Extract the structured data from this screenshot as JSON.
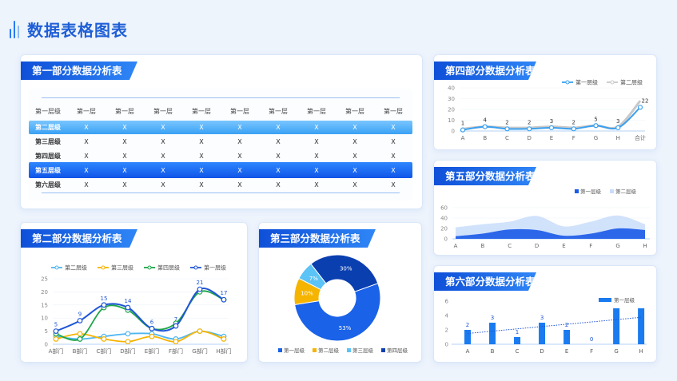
{
  "page_title": "数据表格图表",
  "colors": {
    "accent": "#1f5fd6",
    "banner": "#1a63e6"
  },
  "sections": {
    "s1": {
      "title": "第一部分数据分析表"
    },
    "s2": {
      "title": "第二部分数据分析表"
    },
    "s3": {
      "title": "第三部分数据分析表"
    },
    "s4": {
      "title": "第四部分数据分析表"
    },
    "s5": {
      "title": "第五部分数据分析表"
    },
    "s6": {
      "title": "第六部分数据分析表"
    }
  },
  "table": {
    "headers": [
      "第一层级",
      "第一层",
      "第一层",
      "第一层",
      "第一层",
      "第一层",
      "第一层",
      "第一层",
      "第一层",
      "第一层"
    ],
    "rows": [
      [
        "第二层级",
        "X",
        "X",
        "X",
        "X",
        "X",
        "X",
        "X",
        "X",
        "X"
      ],
      [
        "第三层级",
        "X",
        "X",
        "X",
        "X",
        "X",
        "X",
        "X",
        "X",
        "X"
      ],
      [
        "第四层级",
        "X",
        "X",
        "X",
        "X",
        "X",
        "X",
        "X",
        "X",
        "X"
      ],
      [
        "第五层级",
        "X",
        "X",
        "X",
        "X",
        "X",
        "X",
        "X",
        "X",
        "X"
      ],
      [
        "第六层级",
        "X",
        "X",
        "X",
        "X",
        "X",
        "X",
        "X",
        "X",
        "X"
      ]
    ]
  },
  "chart_data": [
    {
      "id": "s2",
      "type": "line",
      "categories": [
        "A部门",
        "B部门",
        "C部门",
        "D部门",
        "E部门",
        "F部门",
        "G部门",
        "H部门"
      ],
      "ylim": [
        0,
        25
      ],
      "yticks": [
        0,
        5,
        10,
        15,
        20,
        25
      ],
      "series": [
        {
          "name": "第二层级",
          "color": "#4fb6f2",
          "values": [
            3,
            2,
            3,
            4,
            4,
            2,
            5,
            3
          ]
        },
        {
          "name": "第三层级",
          "color": "#f5b400",
          "values": [
            2,
            4,
            2,
            1,
            3,
            1,
            5,
            2
          ]
        },
        {
          "name": "第四层级",
          "color": "#1fa64a",
          "values": [
            4,
            2,
            14,
            13,
            6,
            8,
            20,
            17
          ]
        },
        {
          "name": "第一层级",
          "color": "#1f55d6",
          "values": [
            5,
            9,
            15,
            14,
            6,
            7,
            21,
            17
          ],
          "labels": true
        }
      ]
    },
    {
      "id": "s3",
      "type": "pie",
      "labels": [
        "第一层级",
        "第二层级",
        "第三层级",
        "第四层级"
      ],
      "values": [
        53,
        10,
        7,
        30
      ],
      "value_labels": [
        "53%",
        "10%",
        "7%",
        "30%"
      ],
      "colors": [
        "#1a62e8",
        "#f5b400",
        "#5bc3f5",
        "#0a3fb0"
      ]
    },
    {
      "id": "s4",
      "type": "line",
      "categories": [
        "A",
        "B",
        "C",
        "D",
        "E",
        "F",
        "G",
        "H",
        "合计"
      ],
      "ylim": [
        0,
        40
      ],
      "yticks": [
        0,
        10,
        20,
        30,
        40
      ],
      "series": [
        {
          "name": "第一层级",
          "color": "#3aa0f0",
          "values": [
            1,
            4,
            2,
            2,
            3,
            2,
            5,
            3,
            22
          ],
          "labels": true
        },
        {
          "name": "第二层级",
          "color": "#c8c8c8",
          "values": [
            2,
            4,
            3,
            3,
            4,
            3,
            5,
            4,
            28
          ]
        }
      ]
    },
    {
      "id": "s5",
      "type": "area",
      "categories": [
        "A",
        "B",
        "C",
        "D",
        "E",
        "F",
        "G",
        "H"
      ],
      "ylim": [
        0,
        60
      ],
      "yticks": [
        0,
        20,
        40,
        60
      ],
      "series": [
        {
          "name": "第一层级",
          "color": "#1a5ae8",
          "values": [
            5,
            10,
            18,
            17,
            6,
            10,
            20,
            17
          ]
        },
        {
          "name": "第二层级",
          "color": "#c9ddfa",
          "values": [
            22,
            28,
            33,
            44,
            24,
            33,
            45,
            28
          ]
        }
      ]
    },
    {
      "id": "s6",
      "type": "bar",
      "categories": [
        "A",
        "B",
        "C",
        "D",
        "E",
        "F",
        "G",
        "H"
      ],
      "ylim": [
        0,
        6
      ],
      "yticks": [
        0,
        2,
        4,
        6
      ],
      "series": [
        {
          "name": "第一层级",
          "color": "#1a7af0",
          "values": [
            2,
            3,
            1,
            3,
            2,
            0,
            5,
            5
          ],
          "value_labels": [
            "2",
            "3",
            "1",
            "3",
            "2",
            "0",
            "",
            ""
          ]
        }
      ],
      "trendline": true,
      "legend_label": "第一层级"
    }
  ]
}
